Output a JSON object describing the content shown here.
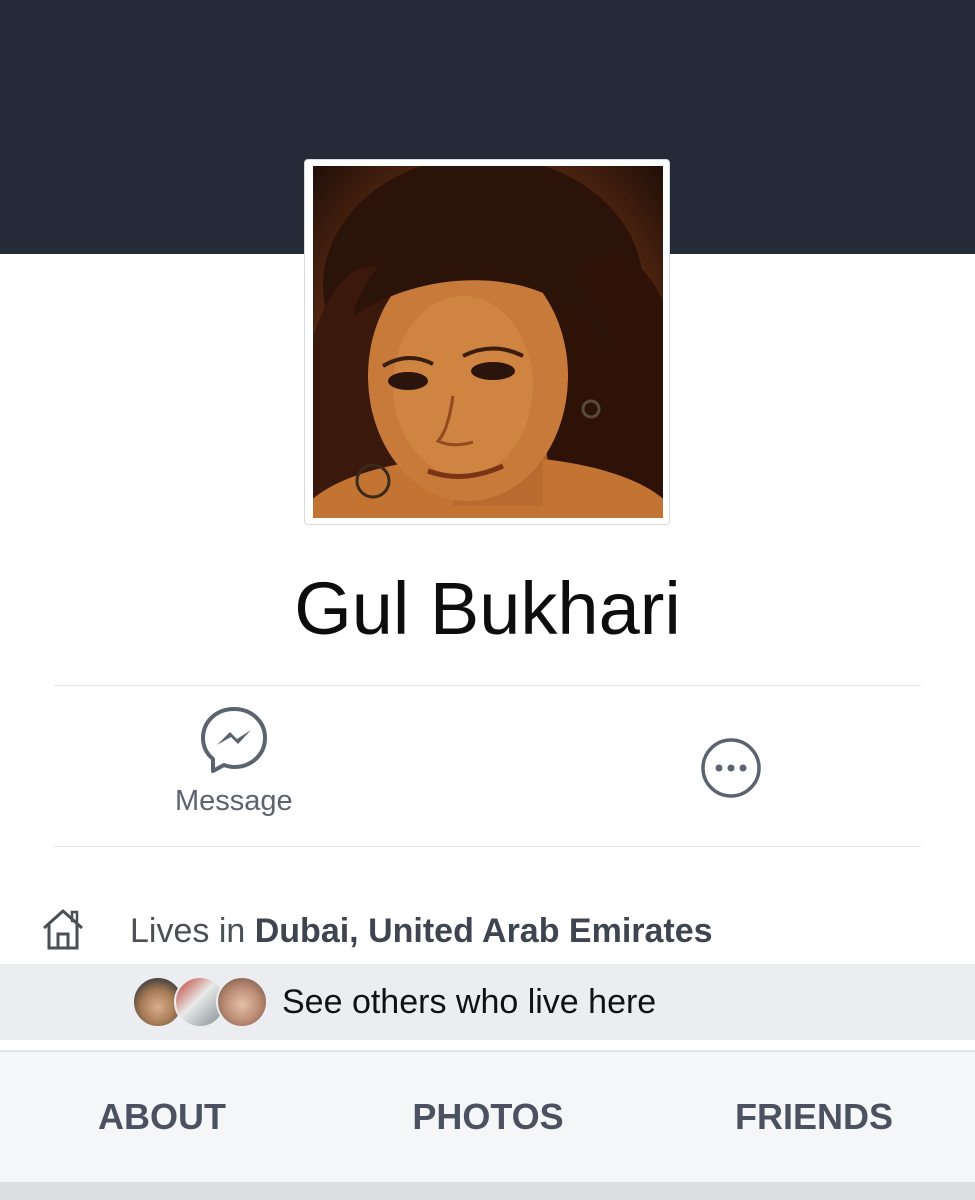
{
  "profile": {
    "name": "Gul Bukhari"
  },
  "actions": {
    "message_label": "Message",
    "more_icon": "more-dots-icon"
  },
  "info": {
    "lives_prefix": "Lives in ",
    "city": "Dubai, United Arab Emirates",
    "icon": "home-icon"
  },
  "others": {
    "label": "See others who live here"
  },
  "tabs": [
    {
      "label": "ABOUT"
    },
    {
      "label": "PHOTOS"
    },
    {
      "label": "FRIENDS"
    }
  ],
  "colors": {
    "cover": "#242a37",
    "tab_text": "#4b5160",
    "icon_gray": "#5b6270"
  }
}
